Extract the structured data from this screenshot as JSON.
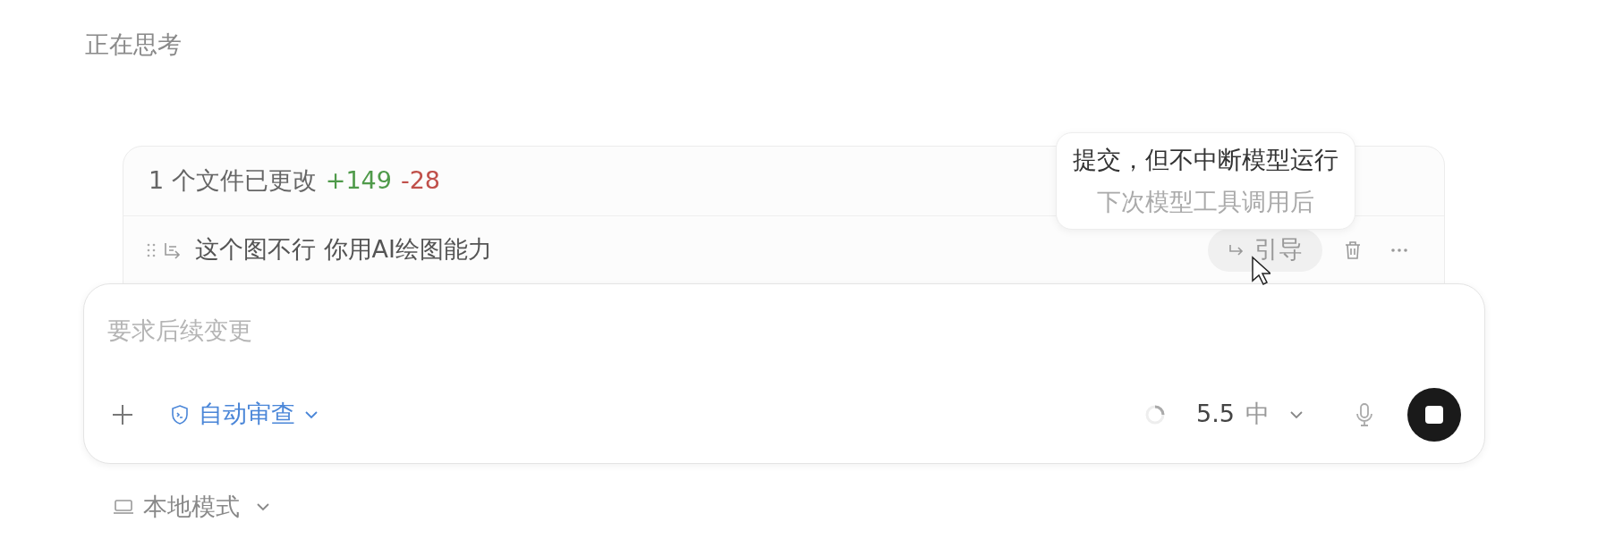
{
  "status": "正在思考",
  "changes": {
    "summary": "1 个文件已更改",
    "added": "+149",
    "removed": "-28"
  },
  "queue": [
    {
      "text": "这个图不行 你用AI绘图能力",
      "action": "引导",
      "hovered": true
    }
  ],
  "tooltip": {
    "title": "提交，但不中断模型运行",
    "subtitle": "下次模型工具调用后"
  },
  "composer": {
    "placeholder": "要求后续变更",
    "review_mode": "自动审查",
    "model": "5.5",
    "effort": "中",
    "running": true
  },
  "footer": {
    "mode": "本地模式"
  }
}
